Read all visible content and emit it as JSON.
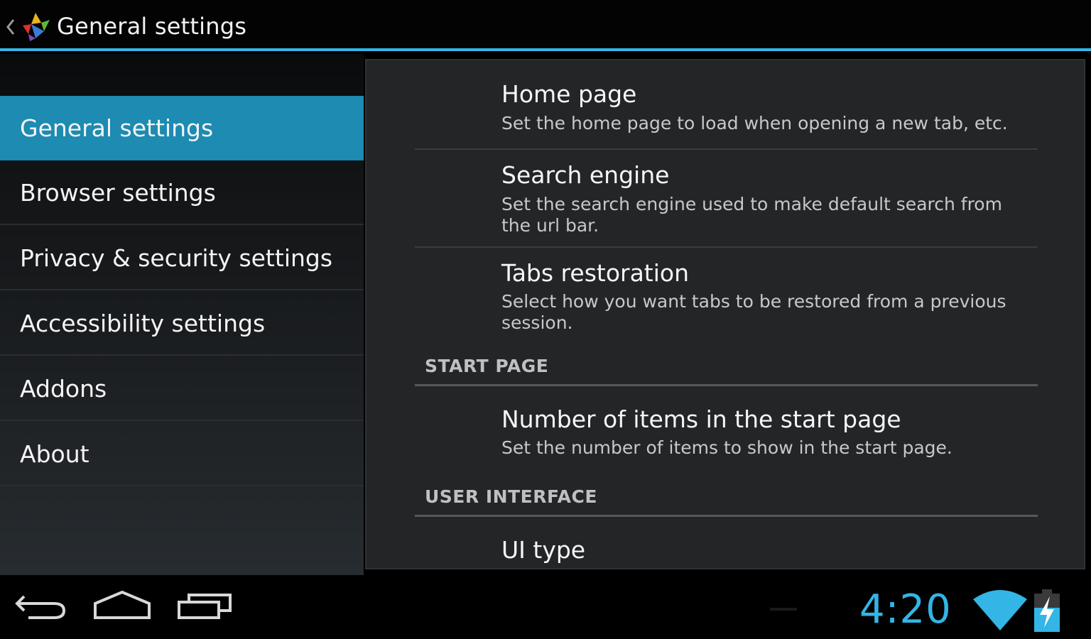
{
  "actionbar": {
    "title": "General settings",
    "back_icon": "chevron-left-icon",
    "app_icon": "app-logo-icon"
  },
  "headers": [
    {
      "label": "General settings",
      "selected": true
    },
    {
      "label": "Browser settings",
      "selected": false
    },
    {
      "label": "Privacy & security settings",
      "selected": false
    },
    {
      "label": "Accessibility settings",
      "selected": false
    },
    {
      "label": "Addons",
      "selected": false
    },
    {
      "label": "About",
      "selected": false
    }
  ],
  "prefs": {
    "home_page": {
      "title": "Home page",
      "summary": "Set the home page to load when opening a new tab, etc."
    },
    "search_engine": {
      "title": "Search engine",
      "summary": "Set the search engine used to make default search from the url bar."
    },
    "tabs_restoration": {
      "title": "Tabs restoration",
      "summary": "Select how you want tabs to be restored from a previous session."
    },
    "start_page_category": "START PAGE",
    "start_page_items": {
      "title": "Number of items in the start page",
      "summary": "Set the number of items to show in the start page."
    },
    "ui_category": "USER INTERFACE",
    "ui_type": {
      "title": "UI type"
    }
  },
  "statusbar": {
    "clock": "4:20",
    "accent_color": "#33b5e5",
    "icons": [
      "back-icon",
      "home-icon",
      "recent-apps-icon",
      "wifi-icon",
      "battery-charging-icon"
    ]
  }
}
